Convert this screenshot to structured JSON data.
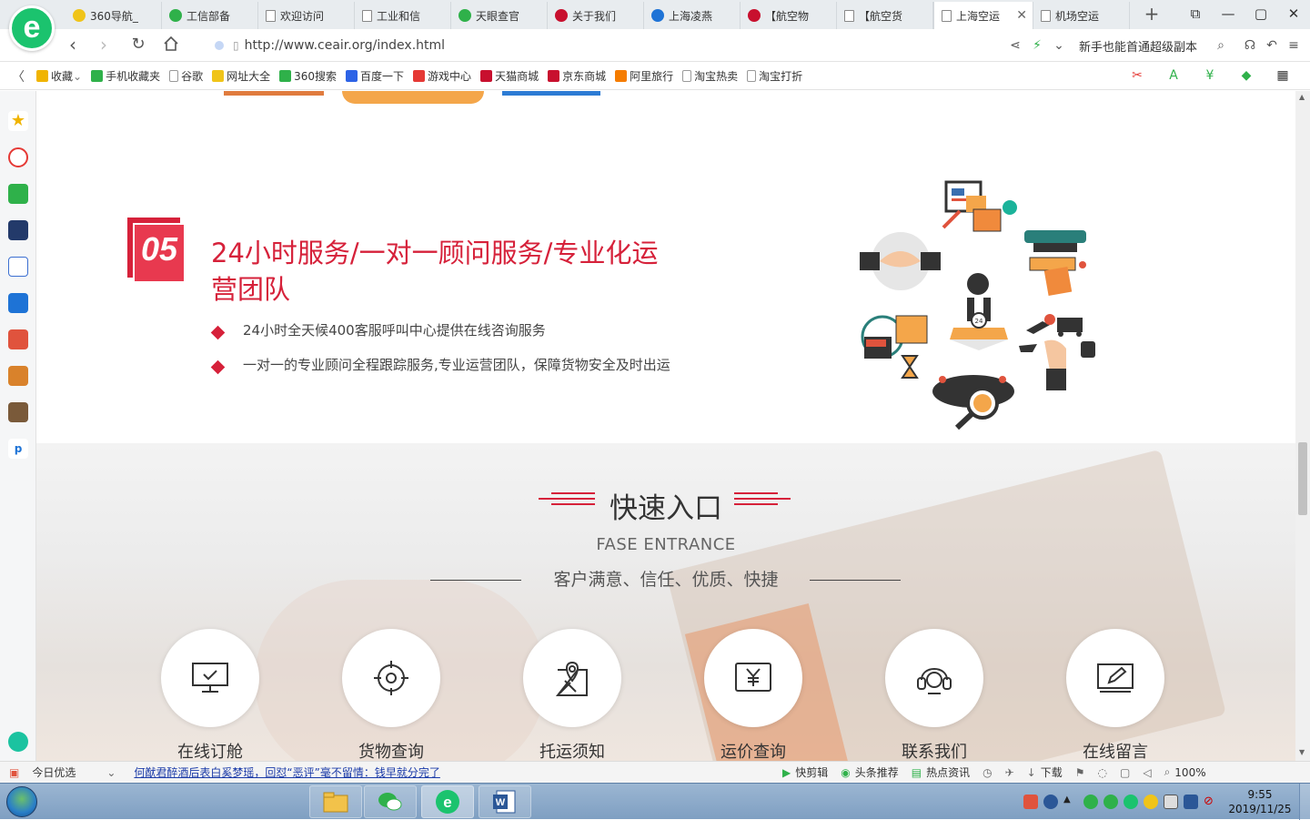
{
  "browser": {
    "tabs": [
      {
        "label": "360导航_",
        "fav_color": "#f0c419",
        "active": false
      },
      {
        "label": "工信部备",
        "fav_color": "#2fb14a",
        "active": false
      },
      {
        "label": "欢迎访问",
        "fav_color": "doc",
        "active": false
      },
      {
        "label": "工业和信",
        "fav_color": "doc",
        "active": false
      },
      {
        "label": "天眼查官",
        "fav_color": "#2fb14a",
        "active": false
      },
      {
        "label": "关于我们",
        "fav_color": "#c8102e",
        "active": false
      },
      {
        "label": "上海凌燕",
        "fav_color": "#1e73d6",
        "active": false
      },
      {
        "label": "【航空物",
        "fav_color": "#c8102e",
        "active": false
      },
      {
        "label": "【航空货",
        "fav_color": "doc",
        "active": false
      },
      {
        "label": "上海空运",
        "fav_color": "doc",
        "active": true
      },
      {
        "label": "机场空运",
        "fav_color": "doc",
        "active": false
      }
    ],
    "new_tab": "+",
    "address": "http://www.ceair.org/index.html",
    "search_promo": "新手也能首通超级副本",
    "window_controls": [
      "⧉",
      "—",
      "▢",
      "✕"
    ]
  },
  "bookmarks": [
    {
      "label": "收藏",
      "color": "#f0b400",
      "dropdown": true
    },
    {
      "label": "手机收藏夹",
      "color": "#2fb14a"
    },
    {
      "label": "谷歌",
      "color": "doc"
    },
    {
      "label": "网址大全",
      "color": "#f0c419"
    },
    {
      "label": "360搜索",
      "color": "#2fb14a"
    },
    {
      "label": "百度一下",
      "color": "#2d63e6"
    },
    {
      "label": "游戏中心",
      "color": "#e53935"
    },
    {
      "label": "天猫商城",
      "color": "#c8102e"
    },
    {
      "label": "京东商城",
      "color": "#c8102e"
    },
    {
      "label": "阿里旅行",
      "color": "#f57c00"
    },
    {
      "label": "淘宝热卖",
      "color": "doc"
    },
    {
      "label": "淘宝打折",
      "color": "doc"
    }
  ],
  "section05": {
    "number": "05",
    "title": "24小时服务/一对一顾问服务/专业化运营团队",
    "points": [
      "24小时全天候400客服呼叫中心提供在线咨询服务",
      "一对一的专业顾问全程跟踪服务,专业运营团队，保障货物安全及时出运"
    ]
  },
  "entrance": {
    "title": "快速入口",
    "subtitle": "FASE ENTRANCE",
    "slogan": "客户满意、信任、优质、快捷",
    "items": [
      {
        "label": "在线订舱",
        "icon": "monitor-check-icon"
      },
      {
        "label": "货物查询",
        "icon": "crosshair-icon"
      },
      {
        "label": "托运须知",
        "icon": "map-pin-icon"
      },
      {
        "label": "运价查询",
        "icon": "yen-screen-icon"
      },
      {
        "label": "联系我们",
        "icon": "headset-icon"
      },
      {
        "label": "在线留言",
        "icon": "edit-icon"
      }
    ]
  },
  "statusbar": {
    "today": "今日优选",
    "news": "何猷君醉酒后表白奚梦瑶，回怼“恶评”毫不留情：钱早就分完了",
    "items": [
      "快剪辑",
      "头条推荐",
      "热点资讯",
      "下载"
    ],
    "zoom": "100%"
  },
  "taskbar": {
    "time": "9:55",
    "date": "2019/11/25"
  },
  "colors": {
    "accent_red": "#d6213a",
    "browser_green": "#1bc36e",
    "taskbar_blue": "#8aa8c8"
  }
}
